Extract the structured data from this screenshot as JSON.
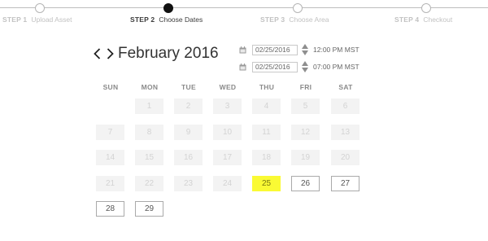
{
  "stepper": {
    "steps": [
      {
        "number": "STEP 1",
        "name": "Upload Asset",
        "active": false
      },
      {
        "number": "STEP 2",
        "name": "Choose Dates",
        "active": true
      },
      {
        "number": "STEP 3",
        "name": "Choose Area",
        "active": false
      },
      {
        "number": "STEP 4",
        "name": "Checkout",
        "active": false
      }
    ]
  },
  "calendar": {
    "month_title": "February 2016",
    "prev_icon": "chevron-left-icon",
    "next_icon": "chevron-right-icon",
    "weekdays": [
      "SUN",
      "MON",
      "TUE",
      "WED",
      "THU",
      "FRI",
      "SAT"
    ],
    "first_weekday_index": 1,
    "days": [
      {
        "n": "1",
        "state": "disabled"
      },
      {
        "n": "2",
        "state": "disabled"
      },
      {
        "n": "3",
        "state": "disabled"
      },
      {
        "n": "4",
        "state": "disabled"
      },
      {
        "n": "5",
        "state": "disabled"
      },
      {
        "n": "6",
        "state": "disabled"
      },
      {
        "n": "7",
        "state": "disabled"
      },
      {
        "n": "8",
        "state": "disabled"
      },
      {
        "n": "9",
        "state": "disabled"
      },
      {
        "n": "10",
        "state": "disabled"
      },
      {
        "n": "11",
        "state": "disabled"
      },
      {
        "n": "12",
        "state": "disabled"
      },
      {
        "n": "13",
        "state": "disabled"
      },
      {
        "n": "14",
        "state": "disabled"
      },
      {
        "n": "15",
        "state": "disabled"
      },
      {
        "n": "16",
        "state": "disabled"
      },
      {
        "n": "17",
        "state": "disabled"
      },
      {
        "n": "18",
        "state": "disabled"
      },
      {
        "n": "19",
        "state": "disabled"
      },
      {
        "n": "20",
        "state": "disabled"
      },
      {
        "n": "21",
        "state": "disabled"
      },
      {
        "n": "22",
        "state": "disabled"
      },
      {
        "n": "23",
        "state": "disabled"
      },
      {
        "n": "24",
        "state": "disabled"
      },
      {
        "n": "25",
        "state": "selected"
      },
      {
        "n": "26",
        "state": "available"
      },
      {
        "n": "27",
        "state": "available"
      },
      {
        "n": "28",
        "state": "available"
      },
      {
        "n": "29",
        "state": "available"
      }
    ],
    "selected_color": "#fafa34"
  },
  "schedule": {
    "start": {
      "date": "02/25/2016",
      "time": "12:00 PM MST"
    },
    "end": {
      "date": "02/25/2016",
      "time": "07:00 PM MST"
    },
    "calendar_icon": "calendar-icon",
    "spinner_icon": "up-down-spinner-icon"
  }
}
